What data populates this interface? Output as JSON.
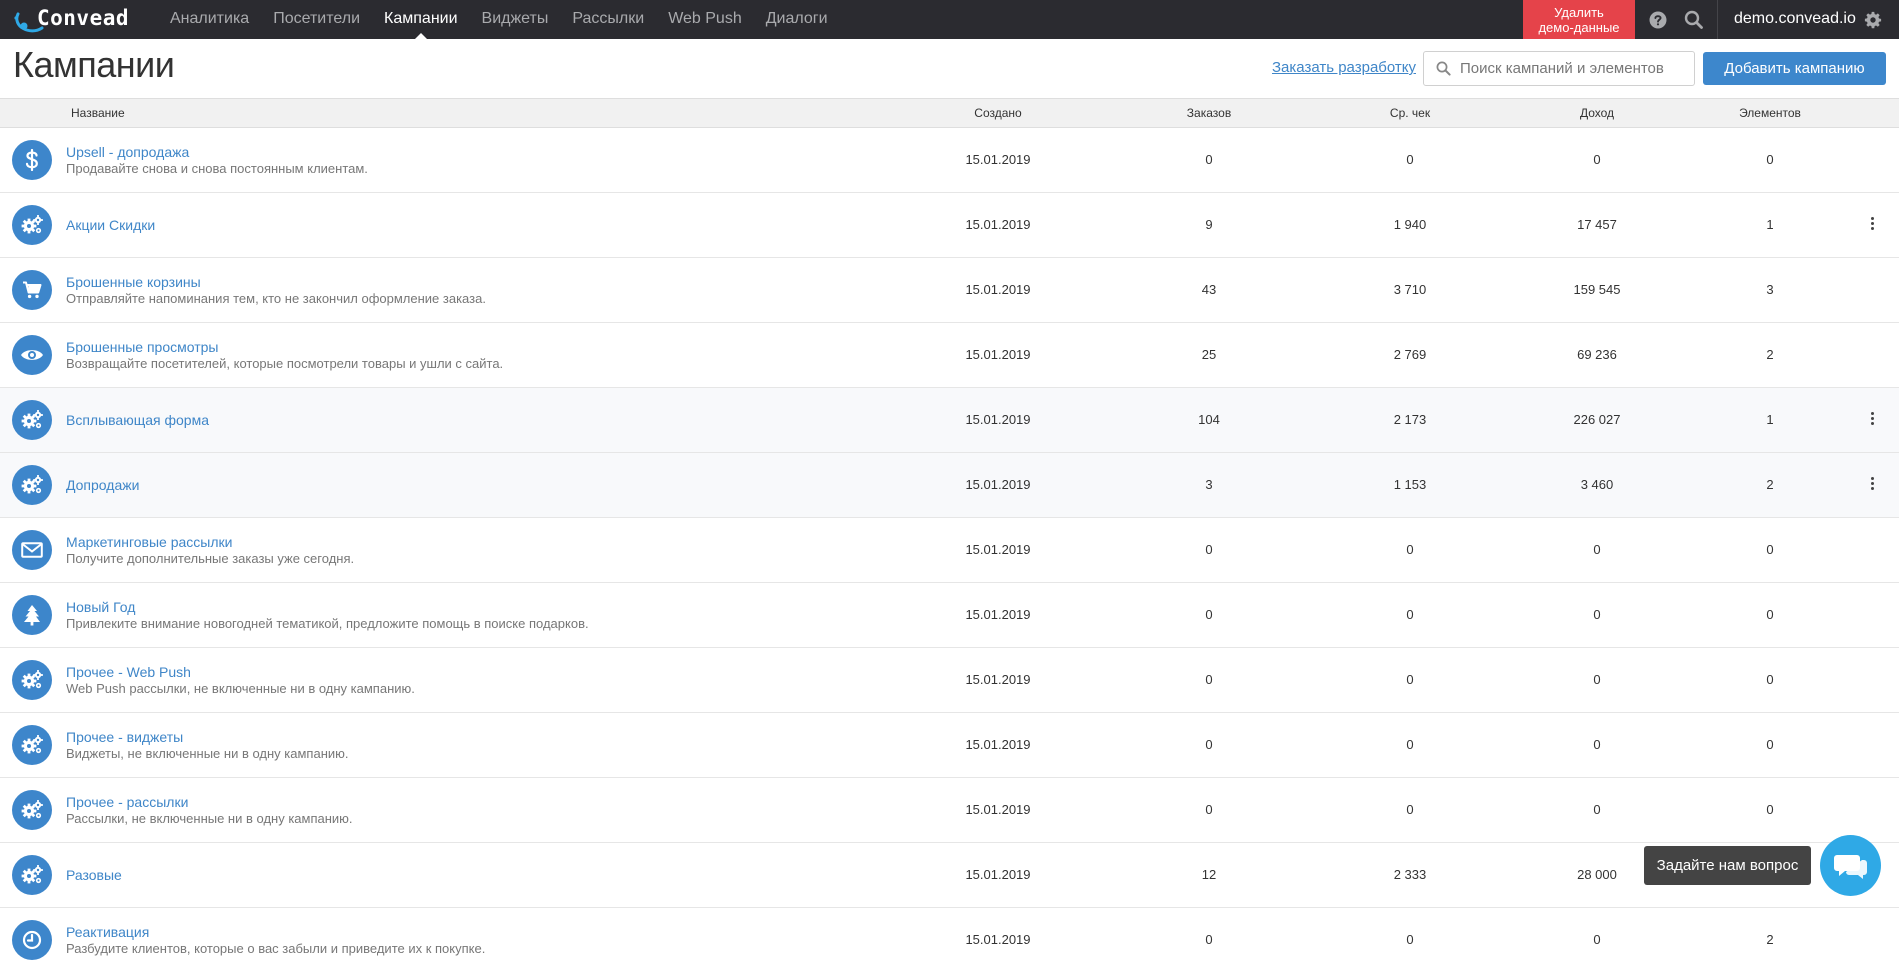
{
  "app": {
    "logo_text": "Convead",
    "nav": [
      {
        "label": "Аналитика",
        "active": false
      },
      {
        "label": "Посетители",
        "active": false
      },
      {
        "label": "Кампании",
        "active": true
      },
      {
        "label": "Виджеты",
        "active": false
      },
      {
        "label": "Рассылки",
        "active": false
      },
      {
        "label": "Web Push",
        "active": false
      },
      {
        "label": "Диалоги",
        "active": false
      }
    ],
    "demo_button_line1": "Удалить",
    "demo_button_line2": "демо-данные",
    "account": "demo.convead.io"
  },
  "page": {
    "title": "Кампании",
    "order_dev_link": "Заказать разработку",
    "search_placeholder": "Поиск кампаний и элементов",
    "add_button": "Добавить кампанию"
  },
  "table": {
    "columns": {
      "name": "Название",
      "created": "Создано",
      "orders": "Заказов",
      "avg_check": "Ср. чек",
      "revenue": "Доход",
      "elements": "Элементов"
    },
    "rows": [
      {
        "icon": "dollar-icon",
        "name": "Upsell - допродажа",
        "desc": "Продавайте снова и снова постоянным клиентам.",
        "created": "15.01.2019",
        "orders": "0",
        "avg_check": "0",
        "revenue": "0",
        "elements": "0",
        "menu": false,
        "alt": false
      },
      {
        "icon": "gears-icon",
        "name": "Акции Скидки",
        "desc": "",
        "created": "15.01.2019",
        "orders": "9",
        "avg_check": "1 940",
        "revenue": "17 457",
        "elements": "1",
        "menu": true,
        "alt": false
      },
      {
        "icon": "cart-icon",
        "name": "Брошенные корзины",
        "desc": "Отправляйте напоминания тем, кто не закончил оформление заказа.",
        "created": "15.01.2019",
        "orders": "43",
        "avg_check": "3 710",
        "revenue": "159 545",
        "elements": "3",
        "menu": false,
        "alt": false
      },
      {
        "icon": "eye-icon",
        "name": "Брошенные просмотры",
        "desc": "Возвращайте посетителей, которые посмотрели товары и ушли с сайта.",
        "created": "15.01.2019",
        "orders": "25",
        "avg_check": "2 769",
        "revenue": "69 236",
        "elements": "2",
        "menu": false,
        "alt": false
      },
      {
        "icon": "gears-icon",
        "name": "Всплывающая форма",
        "desc": "",
        "created": "15.01.2019",
        "orders": "104",
        "avg_check": "2 173",
        "revenue": "226 027",
        "elements": "1",
        "menu": true,
        "alt": true
      },
      {
        "icon": "gears-icon",
        "name": "Допродажи",
        "desc": "",
        "created": "15.01.2019",
        "orders": "3",
        "avg_check": "1 153",
        "revenue": "3 460",
        "elements": "2",
        "menu": true,
        "alt": true
      },
      {
        "icon": "envelope-icon",
        "name": "Маркетинговые рассылки",
        "desc": "Получите дополнительные заказы уже сегодня.",
        "created": "15.01.2019",
        "orders": "0",
        "avg_check": "0",
        "revenue": "0",
        "elements": "0",
        "menu": false,
        "alt": false
      },
      {
        "icon": "tree-icon",
        "name": "Новый Год",
        "desc": "Привлеките внимание новогодней тематикой, предложите помощь в поиске подарков.",
        "created": "15.01.2019",
        "orders": "0",
        "avg_check": "0",
        "revenue": "0",
        "elements": "0",
        "menu": false,
        "alt": false
      },
      {
        "icon": "gears-icon",
        "name": "Прочее - Web Push",
        "desc": "Web Push рассылки, не включенные ни в одну кампанию.",
        "created": "15.01.2019",
        "orders": "0",
        "avg_check": "0",
        "revenue": "0",
        "elements": "0",
        "menu": false,
        "alt": false
      },
      {
        "icon": "gears-icon",
        "name": "Прочее - виджеты",
        "desc": "Виджеты, не включенные ни в одну кампанию.",
        "created": "15.01.2019",
        "orders": "0",
        "avg_check": "0",
        "revenue": "0",
        "elements": "0",
        "menu": false,
        "alt": false
      },
      {
        "icon": "gears-icon",
        "name": "Прочее - рассылки",
        "desc": "Рассылки, не включенные ни в одну кампанию.",
        "created": "15.01.2019",
        "orders": "0",
        "avg_check": "0",
        "revenue": "0",
        "elements": "0",
        "menu": false,
        "alt": false
      },
      {
        "icon": "gears-icon",
        "name": "Разовые",
        "desc": "",
        "created": "15.01.2019",
        "orders": "12",
        "avg_check": "2 333",
        "revenue": "28 000",
        "elements": "",
        "menu": false,
        "alt": false
      },
      {
        "icon": "clock-icon",
        "name": "Реактивация",
        "desc": "Разбудите клиентов, которые о вас забыли и приведите их к покупке.",
        "created": "15.01.2019",
        "orders": "0",
        "avg_check": "0",
        "revenue": "0",
        "elements": "2",
        "menu": false,
        "alt": false
      }
    ]
  },
  "help": {
    "tooltip": "Задайте нам вопрос"
  },
  "colors": {
    "topbar": "#2b2b30",
    "accent": "#3d87cc",
    "danger": "#e5434a",
    "chat": "#2fa9e6"
  }
}
